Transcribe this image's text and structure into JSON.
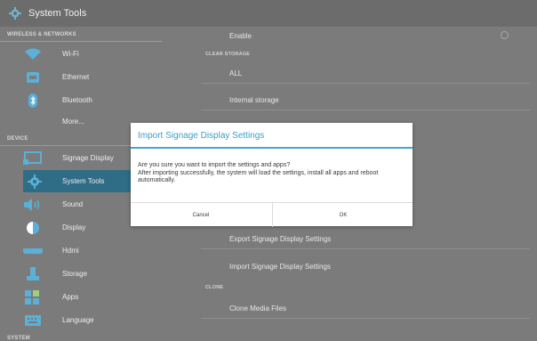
{
  "window": {
    "title": "System Tools"
  },
  "sidebar": {
    "categories": [
      "WIRELESS & NETWORKS",
      "DEVICE",
      "SYSTEM"
    ],
    "items": [
      {
        "label": "Wi-Fi",
        "icon": "wifi-icon"
      },
      {
        "label": "Ethernet",
        "icon": "ethernet-icon"
      },
      {
        "label": "Bluetooth",
        "icon": "bluetooth-icon"
      },
      {
        "label": "More...",
        "icon": ""
      },
      {
        "label": "Signage Display",
        "icon": "signage-display-icon"
      },
      {
        "label": "System Tools",
        "icon": "gear-icon",
        "selected": true
      },
      {
        "label": "Sound",
        "icon": "speaker-icon"
      },
      {
        "label": "Display",
        "icon": "display-icon"
      },
      {
        "label": "Hdmi",
        "icon": "hdmi-icon"
      },
      {
        "label": "Storage",
        "icon": "storage-icon"
      },
      {
        "label": "Apps",
        "icon": "apps-icon"
      },
      {
        "label": "Language",
        "icon": "keyboard-icon"
      }
    ]
  },
  "pane": {
    "enable_label": "Enable",
    "sections": [
      "CLEAR STORAGE",
      "CLONE"
    ],
    "rows": {
      "all": "ALL",
      "internal_storage": "Internal storage",
      "export_settings": "Export Signage Display Settings",
      "import_settings": "Import Signage Display Settings",
      "clone_media": "Clone Media Files"
    }
  },
  "dialog": {
    "title": "Import Signage Display Settings",
    "message_line1": "Are you sure you want to import the settings and apps?",
    "message_line2": "After importing successfully, the system will load the settings, install all apps and reboot automatically.",
    "cancel_label": "Cancel",
    "ok_label": "OK"
  },
  "colors": {
    "accent": "#45a6cf",
    "selected": "#2f6c86"
  }
}
